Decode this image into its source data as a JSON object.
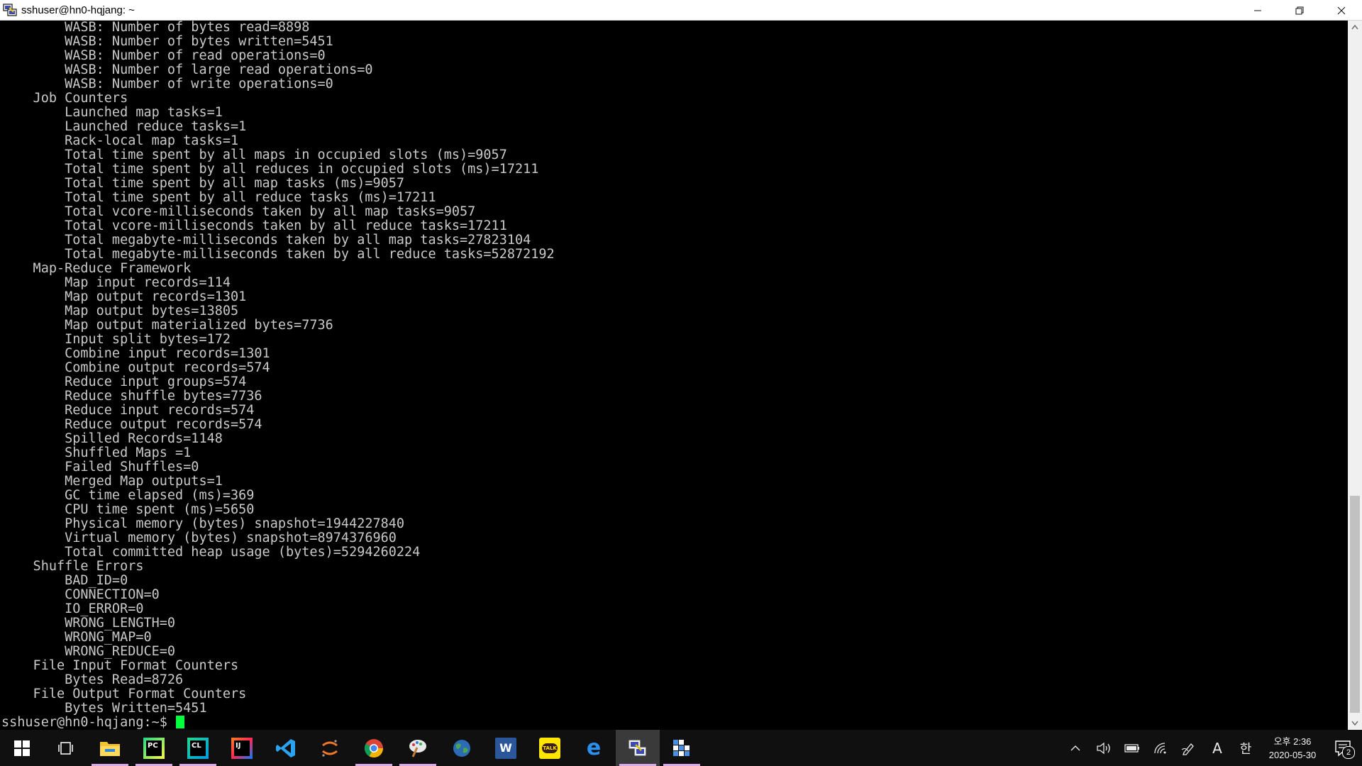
{
  "window": {
    "title": "sshuser@hn0-hqjang: ~",
    "minimize_glyph": "—",
    "restore_glyph": "❐",
    "close_glyph": "✕"
  },
  "terminal": {
    "lines": [
      "        WASB: Number of bytes read=8898",
      "        WASB: Number of bytes written=5451",
      "        WASB: Number of read operations=0",
      "        WASB: Number of large read operations=0",
      "        WASB: Number of write operations=0",
      "    Job Counters",
      "        Launched map tasks=1",
      "        Launched reduce tasks=1",
      "        Rack-local map tasks=1",
      "        Total time spent by all maps in occupied slots (ms)=9057",
      "        Total time spent by all reduces in occupied slots (ms)=17211",
      "        Total time spent by all map tasks (ms)=9057",
      "        Total time spent by all reduce tasks (ms)=17211",
      "        Total vcore-milliseconds taken by all map tasks=9057",
      "        Total vcore-milliseconds taken by all reduce tasks=17211",
      "        Total megabyte-milliseconds taken by all map tasks=27823104",
      "        Total megabyte-milliseconds taken by all reduce tasks=52872192",
      "    Map-Reduce Framework",
      "        Map input records=114",
      "        Map output records=1301",
      "        Map output bytes=13805",
      "        Map output materialized bytes=7736",
      "        Input split bytes=172",
      "        Combine input records=1301",
      "        Combine output records=574",
      "        Reduce input groups=574",
      "        Reduce shuffle bytes=7736",
      "        Reduce input records=574",
      "        Reduce output records=574",
      "        Spilled Records=1148",
      "        Shuffled Maps =1",
      "        Failed Shuffles=0",
      "        Merged Map outputs=1",
      "        GC time elapsed (ms)=369",
      "        CPU time spent (ms)=5650",
      "        Physical memory (bytes) snapshot=1944227840",
      "        Virtual memory (bytes) snapshot=8974376960",
      "        Total committed heap usage (bytes)=5294260224",
      "    Shuffle Errors",
      "        BAD_ID=0",
      "        CONNECTION=0",
      "        IO_ERROR=0",
      "        WRONG_LENGTH=0",
      "        WRONG_MAP=0",
      "        WRONG_REDUCE=0",
      "    File Input Format Counters",
      "        Bytes Read=8726",
      "    File Output Format Counters",
      "        Bytes Written=5451"
    ],
    "prompt": "sshuser@hn0-hqjang:~$"
  },
  "scrollbar": {
    "up_glyph": "▲",
    "down_glyph": "▼",
    "position_fraction": 0.67
  },
  "taskbar": {
    "apps": [
      {
        "icon": "windows-start-icon"
      },
      {
        "icon": "task-view-icon"
      },
      {
        "icon": "file-explorer-icon"
      },
      {
        "icon": "pycharm-icon",
        "label": "PC"
      },
      {
        "icon": "clion-icon",
        "label": "CL"
      },
      {
        "icon": "intellij-icon",
        "label": "IJ"
      },
      {
        "icon": "vscode-icon"
      },
      {
        "icon": "jupyter-icon"
      },
      {
        "icon": "chrome-icon"
      },
      {
        "icon": "paint-icon"
      },
      {
        "icon": "globe-icon"
      },
      {
        "icon": "word-icon",
        "label": "W"
      },
      {
        "icon": "kakaotalk-icon",
        "label": "TALK"
      },
      {
        "icon": "edge-icon",
        "label": "e"
      },
      {
        "icon": "putty-icon"
      },
      {
        "icon": "grid-app-icon"
      }
    ],
    "tray": {
      "chevron": "^",
      "volume": "🔊",
      "battery": "▭",
      "wifi": "◠",
      "pen": "✎",
      "input_mode": "A",
      "ime": "한"
    },
    "clock": {
      "time": "오후 2:36",
      "date": "2020-05-30"
    },
    "notifications": {
      "count": "2"
    }
  },
  "colors": {
    "terminal_bg": "#000000",
    "terminal_fg": "#c9c9c9",
    "cursor": "#00ff3a",
    "taskbar_bg": "#101010",
    "running_indicator": "#d9a8e6"
  }
}
